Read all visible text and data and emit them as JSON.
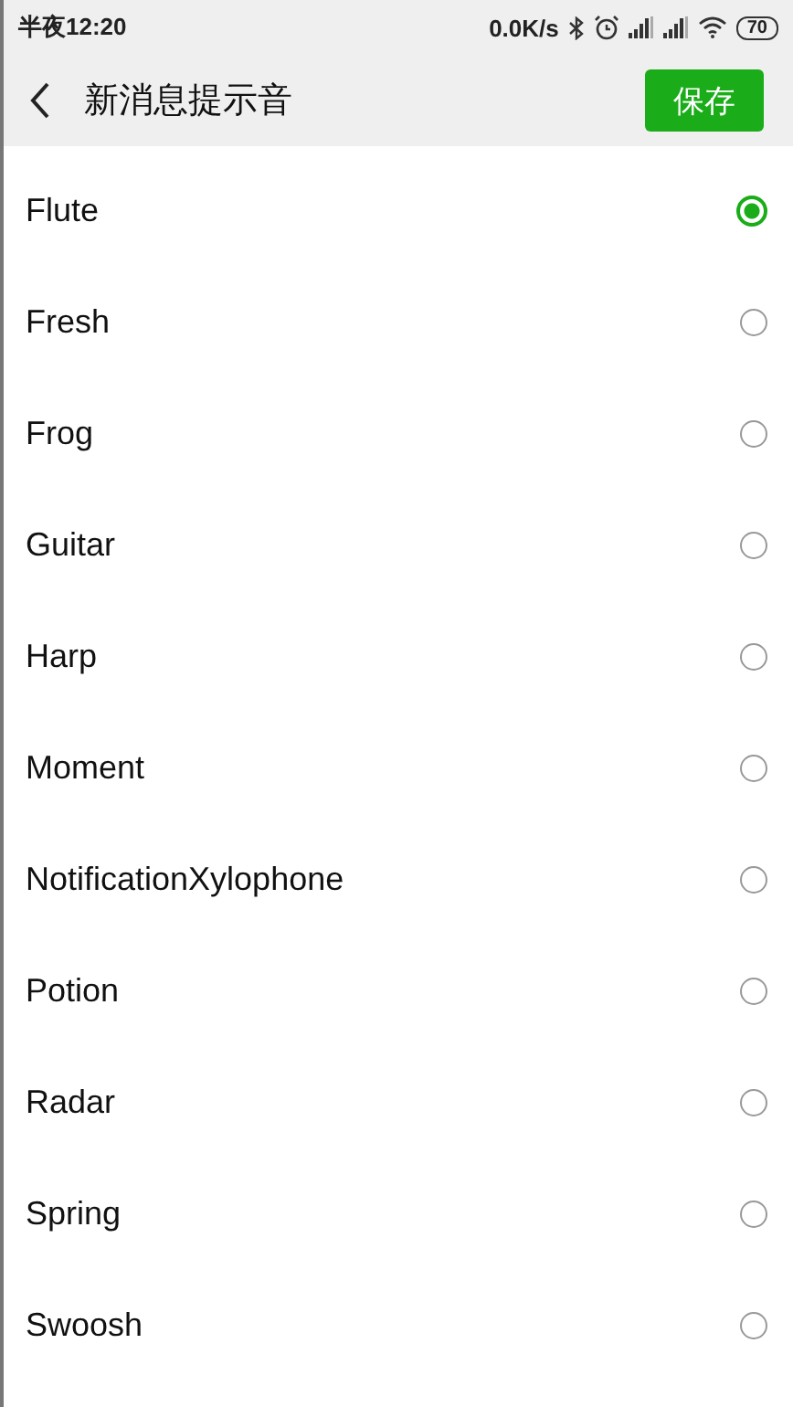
{
  "status_bar": {
    "time": "半夜12:20",
    "speed": "0.0K/s",
    "battery": "70"
  },
  "header": {
    "title": "新消息提示音",
    "save_button": "保存"
  },
  "sounds": [
    {
      "name": "Flute",
      "selected": true
    },
    {
      "name": "Fresh",
      "selected": false
    },
    {
      "name": "Frog",
      "selected": false
    },
    {
      "name": "Guitar",
      "selected": false
    },
    {
      "name": "Harp",
      "selected": false
    },
    {
      "name": "Moment",
      "selected": false
    },
    {
      "name": "NotificationXylophone",
      "selected": false
    },
    {
      "name": "Potion",
      "selected": false
    },
    {
      "name": "Radar",
      "selected": false
    },
    {
      "name": "Spring",
      "selected": false
    },
    {
      "name": "Swoosh",
      "selected": false
    }
  ]
}
